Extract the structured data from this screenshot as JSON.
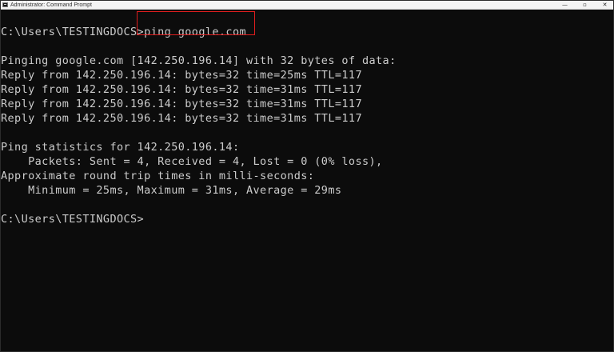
{
  "window": {
    "title": "Administrator: Command Prompt",
    "controls": {
      "minimize": "—",
      "maximize": "▫",
      "close": "✕"
    }
  },
  "terminal": {
    "prompt1": "C:\\Users\\TESTINGDOCS>",
    "command": "ping google.com",
    "lines": [
      "Pinging google.com [142.250.196.14] with 32 bytes of data:",
      "Reply from 142.250.196.14: bytes=32 time=25ms TTL=117",
      "Reply from 142.250.196.14: bytes=32 time=31ms TTL=117",
      "Reply from 142.250.196.14: bytes=32 time=31ms TTL=117",
      "Reply from 142.250.196.14: bytes=32 time=31ms TTL=117",
      "Ping statistics for 142.250.196.14:",
      "    Packets: Sent = 4, Received = 4, Lost = 0 (0% loss),",
      "Approximate round trip times in milli-seconds:",
      "    Minimum = 25ms, Maximum = 31ms, Average = 29ms"
    ],
    "prompt2": "C:\\Users\\TESTINGDOCS>"
  },
  "colors": {
    "background": "#0c0c0c",
    "text": "#cccccc",
    "highlight": "#e01e1e"
  }
}
